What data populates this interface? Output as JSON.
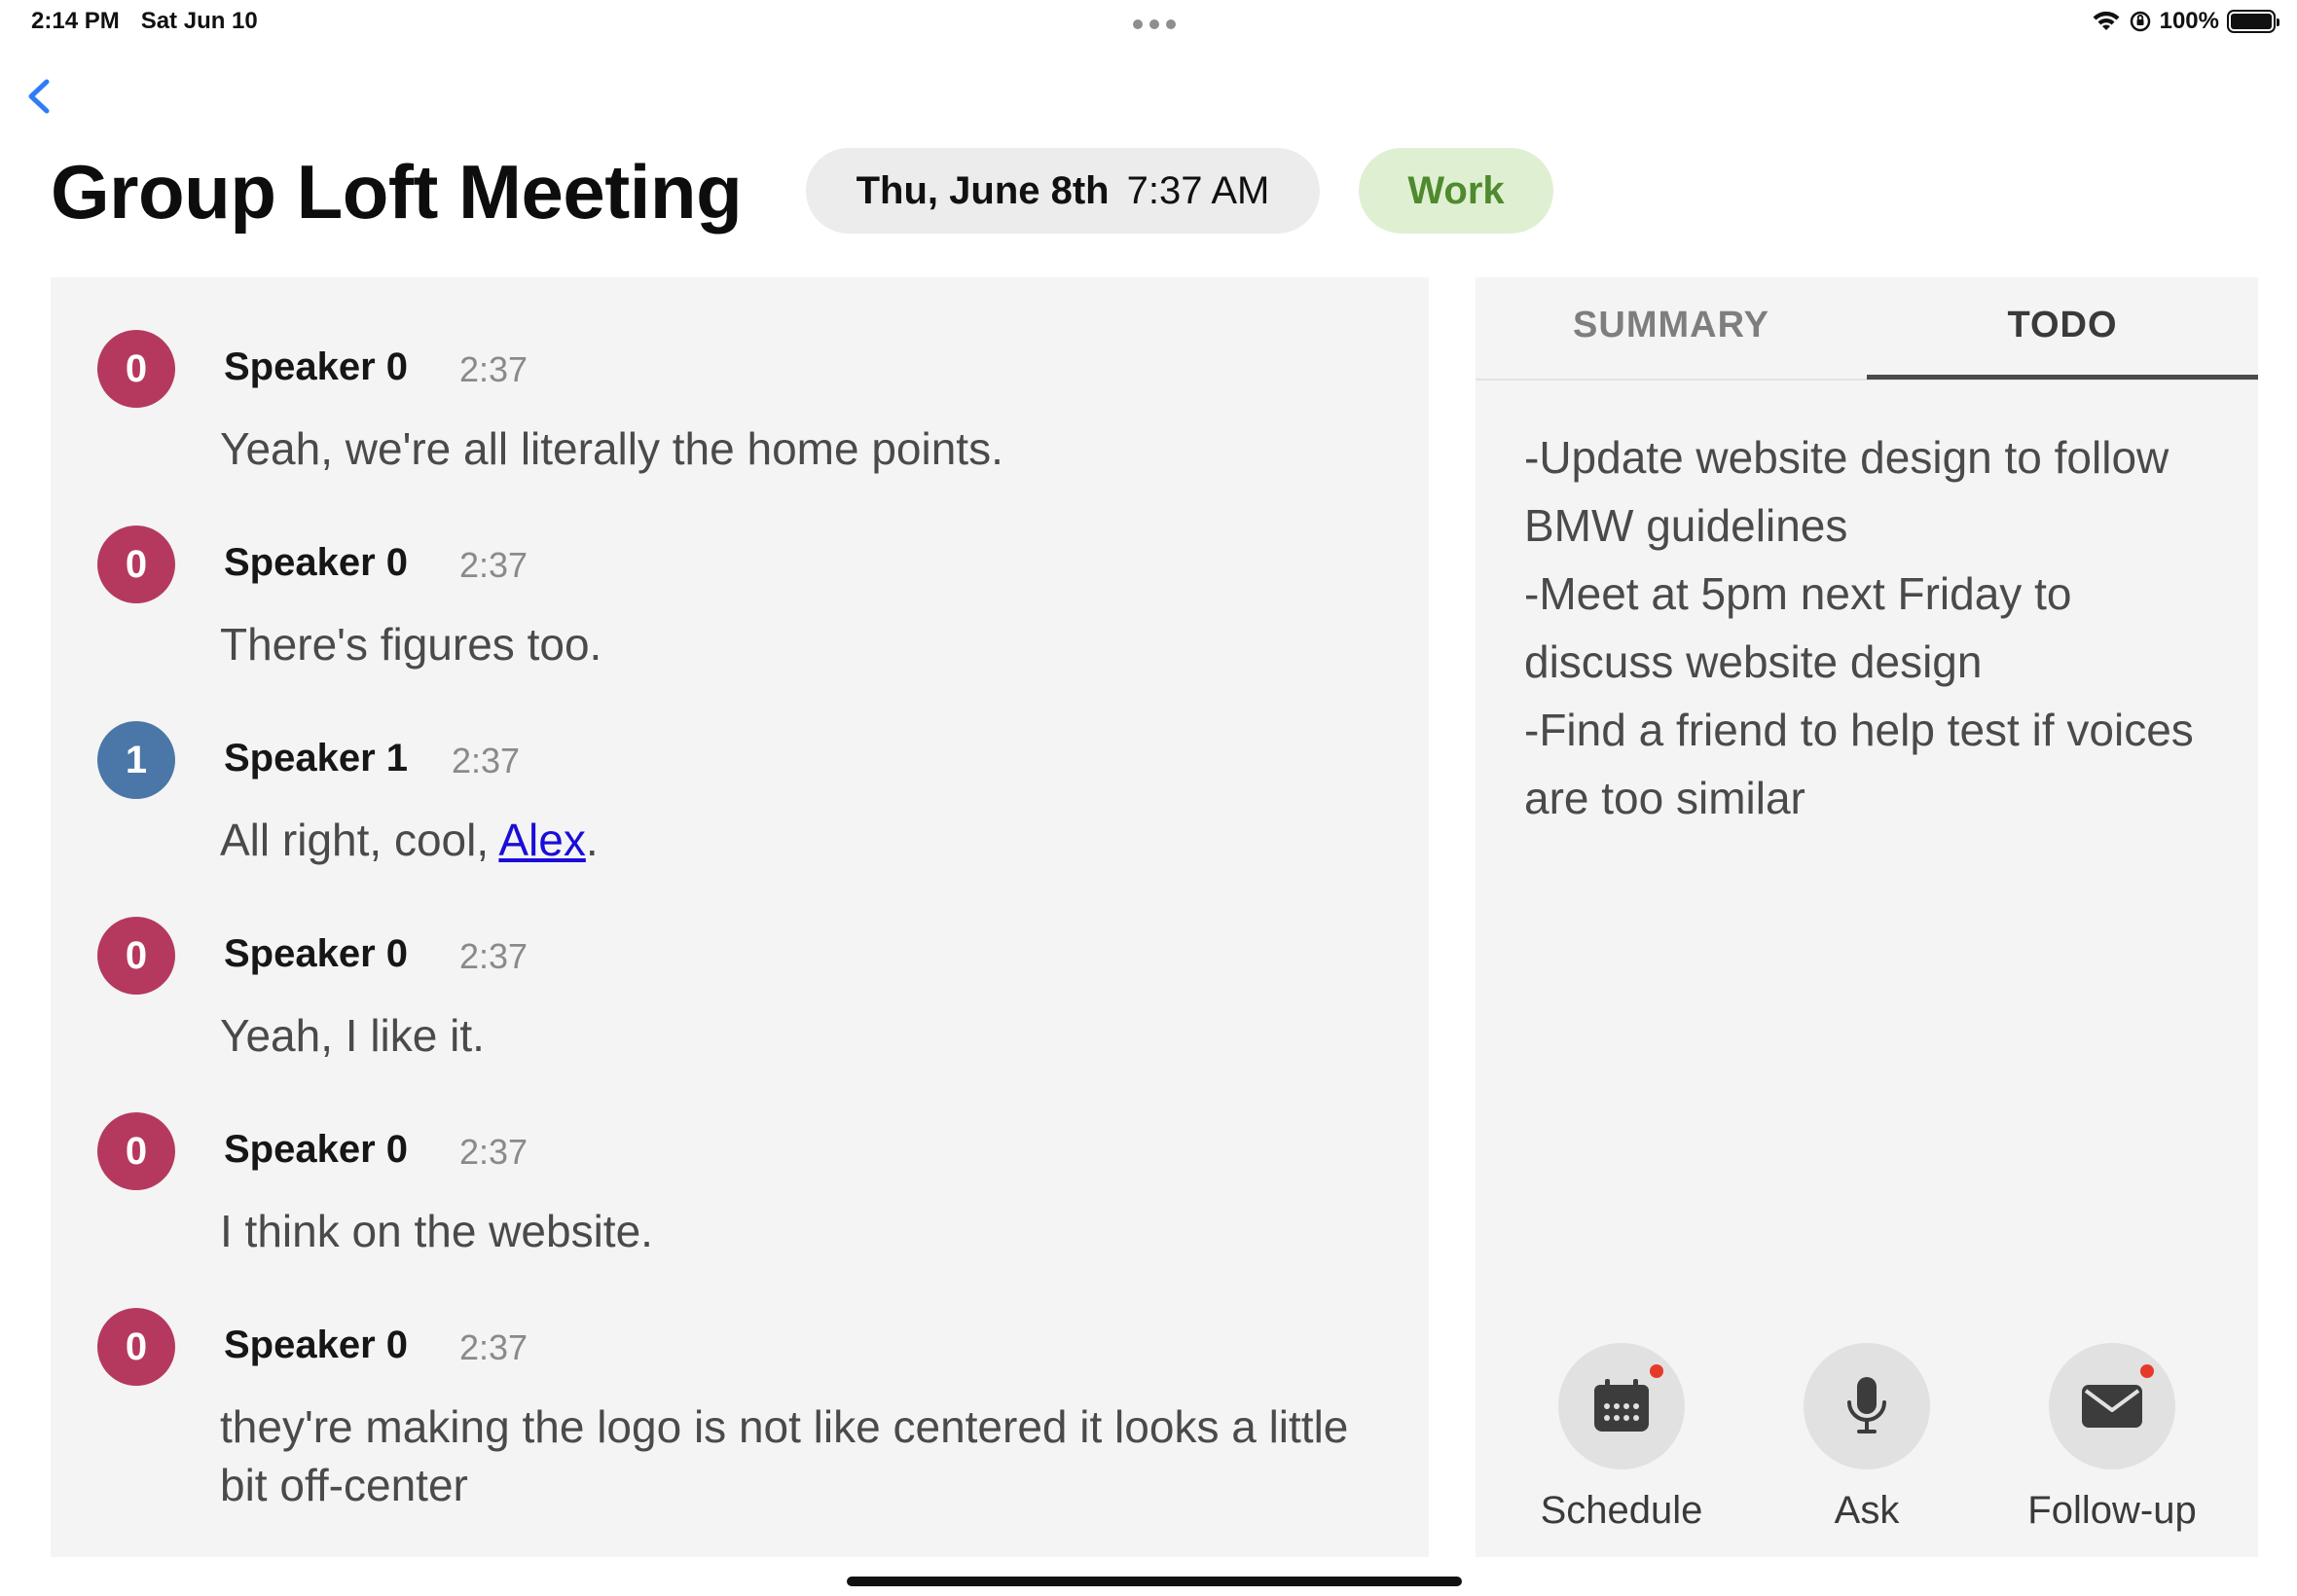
{
  "status_bar": {
    "time": "2:14 PM",
    "date": "Sat Jun 10",
    "battery_text": "100%",
    "icons": [
      "wifi-icon",
      "orientation-lock-icon",
      "battery-icon"
    ]
  },
  "header": {
    "back_icon": "chevron-left-icon",
    "title": "Group Loft Meeting",
    "date": "Thu, June 8th",
    "time": "7:37 AM",
    "tag": "Work"
  },
  "colors": {
    "accent": "#2f7df6",
    "speaker_0": "#b5395f",
    "speaker_1": "#4a77a8",
    "tag_bg": "#dff0d2",
    "tag_text": "#4f8a2e",
    "link": "#1a0dd8",
    "notification_dot": "#e53a2b"
  },
  "transcript": {
    "messages": [
      {
        "avatar": "0",
        "speaker": "Speaker 0",
        "time": "2:37",
        "text": "Yeah, we're all literally the home points."
      },
      {
        "avatar": "0",
        "speaker": "Speaker 0",
        "time": "2:37",
        "text": "There's figures too."
      },
      {
        "avatar": "1",
        "speaker": "Speaker 1",
        "time": "2:37",
        "text_before": "All right, cool, ",
        "link": "Alex",
        "text_after": "."
      },
      {
        "avatar": "0",
        "speaker": "Speaker 0",
        "time": "2:37",
        "text": "Yeah, I like it."
      },
      {
        "avatar": "0",
        "speaker": "Speaker 0",
        "time": "2:37",
        "text": "I think on the website."
      },
      {
        "avatar": "0",
        "speaker": "Speaker 0",
        "time": "2:37",
        "text": "they're making the logo is not like centered it looks a little bit off-center"
      }
    ]
  },
  "side_panel": {
    "tabs": [
      {
        "label": "SUMMARY",
        "active": false
      },
      {
        "label": "TODO",
        "active": true
      }
    ],
    "todo_items": [
      "-Update website design to follow BMW guidelines",
      "-Meet at 5pm next Friday to discuss website design",
      "-Find a friend to help test if voices are too similar"
    ],
    "actions": [
      {
        "label": "Schedule",
        "icon": "calendar-icon",
        "badge": true
      },
      {
        "label": "Ask",
        "icon": "microphone-icon",
        "badge": false
      },
      {
        "label": "Follow-up",
        "icon": "envelope-icon",
        "badge": true
      }
    ]
  }
}
